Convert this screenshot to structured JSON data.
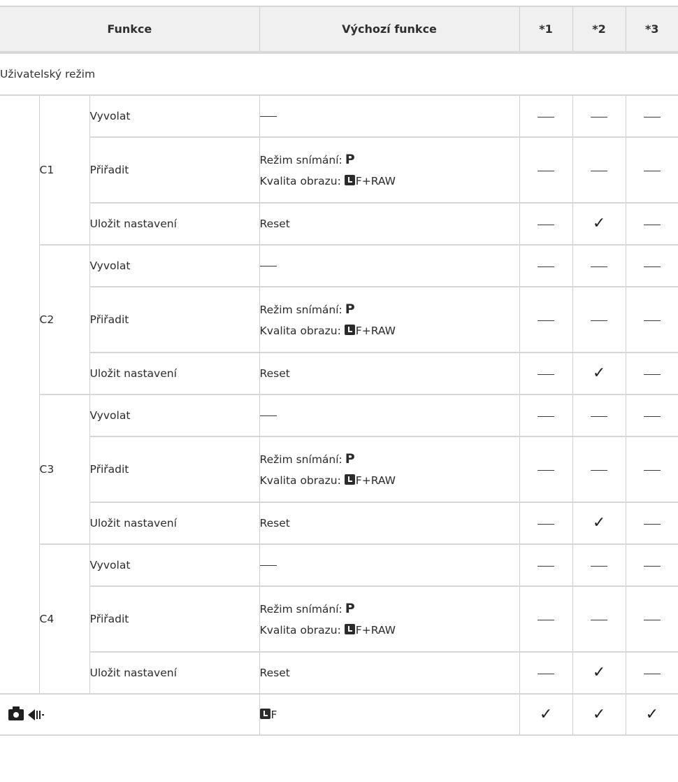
{
  "header": {
    "col_function": "Funkce",
    "col_default": "Výchozí funkce",
    "col_1": "*1",
    "col_2": "*2",
    "col_3": "*3"
  },
  "section_title": "Uživatelský režim",
  "groups": [
    {
      "label": "C1",
      "rows": [
        {
          "function": "Vyvolat",
          "default": "—",
          "m1": "—",
          "m2": "—",
          "m3": "—"
        },
        {
          "function": "Přiřadit",
          "default_line1": "Režim snímání:",
          "default_line1_mode": "P",
          "default_line2_prefix": "Kvalita obrazu:",
          "default_line2_value": "F+RAW",
          "m1": "—",
          "m2": "—",
          "m3": "—"
        },
        {
          "function": "Uložit nastavení",
          "default": "Reset",
          "m1": "—",
          "m2": "✓",
          "m3": "—"
        }
      ]
    },
    {
      "label": "C2",
      "rows": [
        {
          "function": "Vyvolat",
          "default": "—",
          "m1": "—",
          "m2": "—",
          "m3": "—"
        },
        {
          "function": "Přiřadit",
          "default_line1": "Režim snímání:",
          "default_line1_mode": "P",
          "default_line2_prefix": "Kvalita obrazu:",
          "default_line2_value": "F+RAW",
          "m1": "—",
          "m2": "—",
          "m3": "—"
        },
        {
          "function": "Uložit nastavení",
          "default": "Reset",
          "m1": "—",
          "m2": "✓",
          "m3": "—"
        }
      ]
    },
    {
      "label": "C3",
      "rows": [
        {
          "function": "Vyvolat",
          "default": "—",
          "m1": "—",
          "m2": "—",
          "m3": "—"
        },
        {
          "function": "Přiřadit",
          "default_line1": "Režim snímání:",
          "default_line1_mode": "P",
          "default_line2_prefix": "Kvalita obrazu:",
          "default_line2_value": "F+RAW",
          "m1": "—",
          "m2": "—",
          "m3": "—"
        },
        {
          "function": "Uložit nastavení",
          "default": "Reset",
          "m1": "—",
          "m2": "✓",
          "m3": "—"
        }
      ]
    },
    {
      "label": "C4",
      "rows": [
        {
          "function": "Vyvolat",
          "default": "—",
          "m1": "—",
          "m2": "—",
          "m3": "—"
        },
        {
          "function": "Přiřadit",
          "default_line1": "Režim snímání:",
          "default_line1_mode": "P",
          "default_line2_prefix": "Kvalita obrazu:",
          "default_line2_value": "F+RAW",
          "m1": "—",
          "m2": "—",
          "m3": "—"
        },
        {
          "function": "Uložit nastavení",
          "default": "Reset",
          "m1": "—",
          "m2": "✓",
          "m3": "—"
        }
      ]
    }
  ],
  "last_row": {
    "icons": [
      "camera-icon",
      "drive-mode-icon"
    ],
    "default_value": "F",
    "m1": "✓",
    "m2": "✓",
    "m3": "✓"
  }
}
